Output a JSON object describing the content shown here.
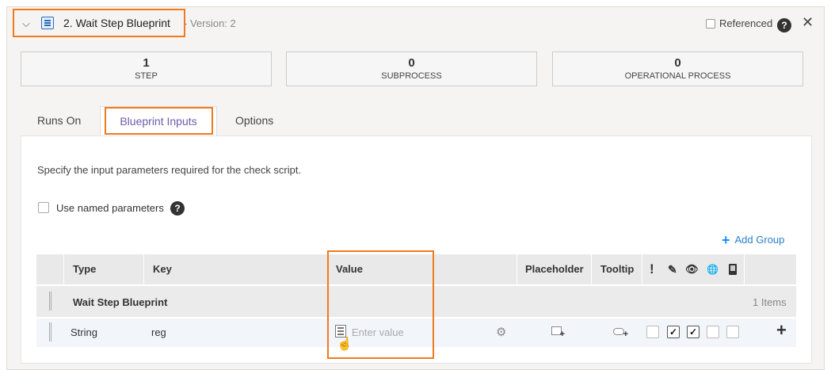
{
  "header": {
    "title": "2.  Wait Step Blueprint",
    "version": "- Version: 2",
    "referenced_label": "Referenced"
  },
  "stats": [
    {
      "value": "1",
      "label": "STEP"
    },
    {
      "value": "0",
      "label": "SUBPROCESS"
    },
    {
      "value": "0",
      "label": "OPERATIONAL PROCESS"
    }
  ],
  "tabs": [
    {
      "label": "Runs On"
    },
    {
      "label": "Blueprint Inputs"
    },
    {
      "label": "Options"
    }
  ],
  "content": {
    "description": "Specify the input parameters required for the check script.",
    "named_params_label": "Use named parameters",
    "add_group_label": "Add Group"
  },
  "table": {
    "columns": {
      "type": "Type",
      "key": "Key",
      "value": "Value",
      "placeholder": "Placeholder",
      "tooltip": "Tooltip"
    },
    "group": {
      "name": "Wait Step Blueprint",
      "count": "1 Items"
    },
    "rows": [
      {
        "type": "String",
        "key": "reg",
        "value_placeholder": "Enter value"
      }
    ]
  },
  "icons": {
    "help": "?",
    "close": "✕",
    "chevron": "⌵",
    "add": "+",
    "required": "!",
    "pencil": "✎",
    "eye": "👁",
    "globe": "🌐",
    "gear": "⚙"
  }
}
